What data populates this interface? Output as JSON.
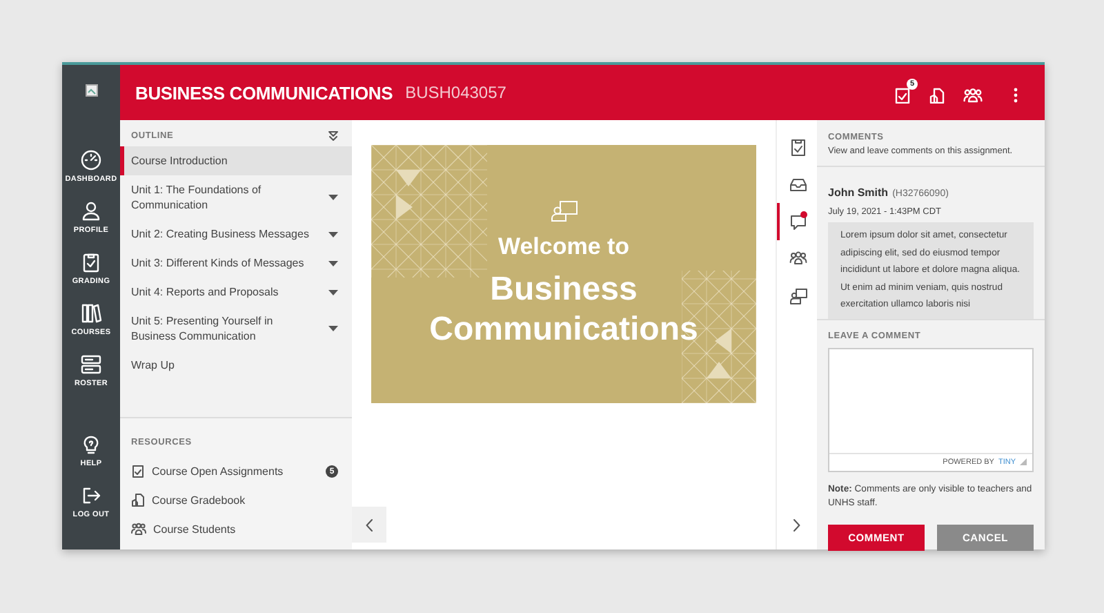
{
  "nav_rail": {
    "items": [
      {
        "label": "DASHBOARD"
      },
      {
        "label": "PROFILE"
      },
      {
        "label": "GRADING"
      },
      {
        "label": "COURSES"
      },
      {
        "label": "ROSTER"
      }
    ],
    "bottom_items": [
      {
        "label": "HELP"
      },
      {
        "label": "LOG OUT"
      }
    ]
  },
  "header": {
    "title": "BUSINESS COMMUNICATIONS",
    "code": "BUSH043057",
    "assignments_badge": "5"
  },
  "outline": {
    "heading": "OUTLINE",
    "items": [
      {
        "label": "Course Introduction",
        "selected": true,
        "expandable": false
      },
      {
        "label": "Unit 1: The Foundations of Communication",
        "selected": false,
        "expandable": true
      },
      {
        "label": "Unit 2: Creating Business Messages",
        "selected": false,
        "expandable": true
      },
      {
        "label": "Unit 3: Different Kinds of Messages",
        "selected": false,
        "expandable": true
      },
      {
        "label": "Unit 4: Reports and Proposals",
        "selected": false,
        "expandable": true
      },
      {
        "label": "Unit 5: Presenting Yourself in Business Communication",
        "selected": false,
        "expandable": true
      },
      {
        "label": "Wrap Up",
        "selected": false,
        "expandable": false
      }
    ]
  },
  "resources": {
    "heading": "RESOURCES",
    "items": [
      {
        "label": "Course Open Assignments",
        "badge": "5"
      },
      {
        "label": "Course Gradebook"
      },
      {
        "label": "Course Students"
      }
    ]
  },
  "welcome_card": {
    "subtitle": "Welcome to",
    "title": "Business Communications"
  },
  "side_rail": {
    "items": [
      {
        "selected": false,
        "notification": false
      },
      {
        "selected": false,
        "notification": false
      },
      {
        "selected": true,
        "notification": true
      },
      {
        "selected": false,
        "notification": false
      },
      {
        "selected": false,
        "notification": false
      }
    ]
  },
  "comments": {
    "heading": "COMMENTS",
    "description": "View and leave comments on this assignment.",
    "entries": [
      {
        "author": "John Smith",
        "author_id": "(H32766090)",
        "date": "July 19, 2021 - 1:43PM CDT",
        "body": "Lorem ipsum dolor sit amet, consectetur adipiscing elit, sed do eiusmod tempor incididunt ut labore et dolore magna aliqua. Ut enim ad minim veniam, quis nostrud exercitation ullamco laboris nisi"
      }
    ],
    "leave_heading": "LEAVE A COMMENT",
    "editor": {
      "powered_by": "POWERED BY",
      "brand": "TINY"
    },
    "note": "**Note:** Comments are only visible to teachers and UNHS staff.",
    "buttons": [
      {
        "label": "COMMENT",
        "kind": "primary"
      },
      {
        "label": "CANCEL",
        "kind": "secondary"
      }
    ]
  }
}
